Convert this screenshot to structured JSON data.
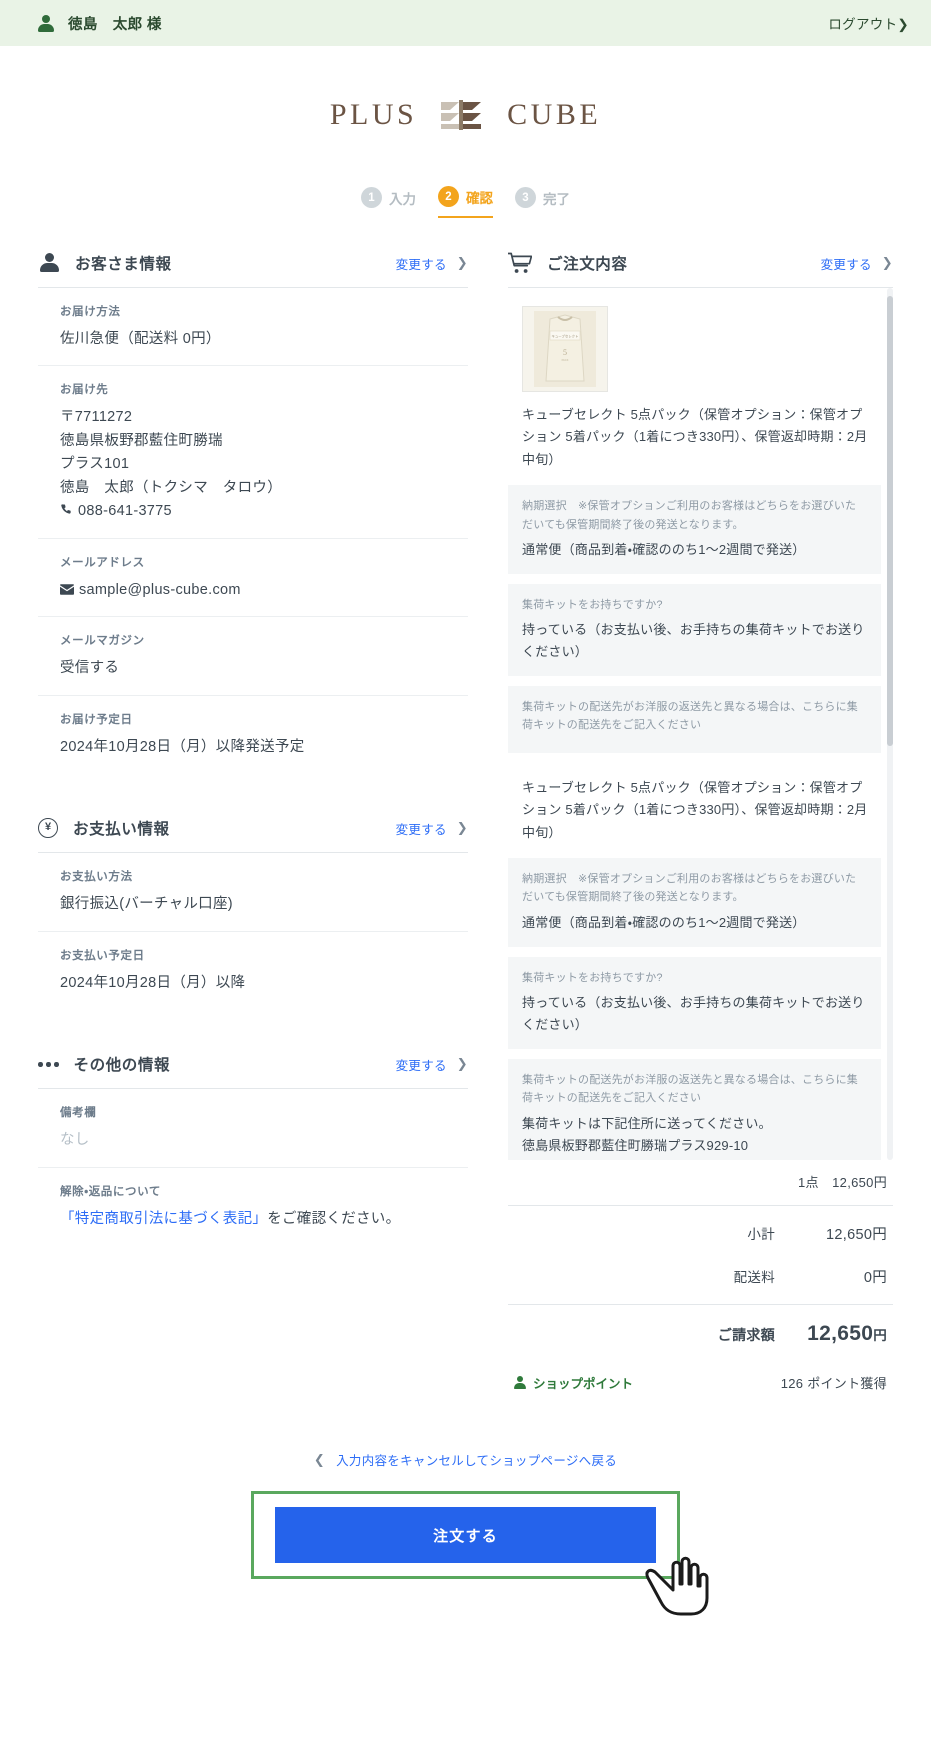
{
  "userbar": {
    "user_icon": "person-icon",
    "username": "徳島　太郎 様",
    "logout_label": "ログアウト",
    "logout_chevron": "❯"
  },
  "brand": {
    "left_word": "PLUS",
    "right_word": "CUBE",
    "mark": "cube-logo-mark"
  },
  "steps": [
    {
      "number": "1",
      "label": "入力",
      "active": false
    },
    {
      "number": "2",
      "label": "確認",
      "active": true
    },
    {
      "number": "3",
      "label": "完了",
      "active": false
    }
  ],
  "customer": {
    "icon": "person-icon",
    "title": "お客さま情報",
    "change_label": "変更する",
    "chevron": "❯",
    "fields": [
      {
        "label": "お届け方法",
        "value": "佐川急便（配送料 0円）"
      },
      {
        "label": "お届け先",
        "value": "〒7711272\n徳島県板野郡藍住町勝瑞\nプラス101\n徳島　太郎（トクシマ　タロウ）",
        "phone": "088-641-3775",
        "phone_icon": "phone-icon"
      },
      {
        "label": "メールアドレス",
        "value": "sample@plus-cube.com",
        "icon": "mail-icon"
      },
      {
        "label": "メールマガジン",
        "value": "受信する"
      },
      {
        "label": "お届け予定日",
        "value": "2024年10月28日（月）以降発送予定"
      }
    ]
  },
  "payment": {
    "icon": "yen-circle-icon",
    "title": "お支払い情報",
    "change_label": "変更する",
    "chevron": "❯",
    "fields": [
      {
        "label": "お支払い方法",
        "value": "銀行振込(バーチャル口座)"
      },
      {
        "label": "お支払い予定日",
        "value": "2024年10月28日（月）以降"
      }
    ]
  },
  "other": {
    "icon": "ellipsis-icon",
    "title": "その他の情報",
    "change_label": "変更する",
    "chevron": "❯",
    "remarks_label": "備考欄",
    "remarks_value": "なし",
    "return_label": "解除・返品について",
    "return_link_text": "「特定商取引法に基づく表記」",
    "return_suffix": "をご確認ください。"
  },
  "order": {
    "icon": "cart-icon",
    "title": "ご注文内容",
    "change_label": "変更する",
    "chevron": "❯",
    "items": [
      {
        "thumb": "product-thumbnail",
        "name": "キューブセレクト 5点パック（保管オプション：保管オプション 5着パック（1着につき330円）、保管返却時期：2月中旬）",
        "options": [
          {
            "question": "納期選択　※保管オプションご利用のお客様はどちらをお選びいただいても保管期間終了後の発送となります。",
            "answer": "通常便（商品到着・確認ののち1〜2週間で発送）"
          },
          {
            "question": "集荷キットをお持ちですか?",
            "answer": "持っている（お支払い後、お手持ちの集荷キットでお送りください）"
          },
          {
            "question": "集荷キットの配送先がお洋服の返送先と異なる場合は、こちらに集荷キットの配送先をご記入ください",
            "answer": ""
          }
        ]
      },
      {
        "thumb": "product-thumbnail",
        "name": "キューブセレクト 5点パック（保管オプション：保管オプション 5着パック（1着につき330円）、保管返却時期：2月中旬）",
        "options": [
          {
            "question": "納期選択　※保管オプションご利用のお客様はどちらをお選びいただいても保管期間終了後の発送となります。",
            "answer": "通常便（商品到着・確認ののち1〜2週間で発送）"
          },
          {
            "question": "集荷キットをお持ちですか?",
            "answer": "持っている（お支払い後、お手持ちの集荷キットでお送りください）"
          },
          {
            "question": "集荷キットの配送先がお洋服の返送先と異なる場合は、こちらに集荷キットの配送先をご記入ください",
            "answer": "集荷キットは下記住所に送ってください。\n徳島県板野郡藍住町勝瑞プラス929-10"
          }
        ]
      }
    ],
    "qty_line": "1点　12,650円",
    "totals": [
      {
        "label": "小計",
        "value": "12,650円"
      },
      {
        "label": "配送料",
        "value": "0円"
      }
    ],
    "grand_label": "ご請求額",
    "grand_amount": "12,650",
    "grand_yen": "円",
    "points_icon": "person-icon",
    "points_label": "ショップポイント",
    "points_value": "126 ポイント獲得"
  },
  "bottom": {
    "cancel_chevron": "❮",
    "cancel_label": "入力内容をキャンセルしてショップページへ戻る",
    "submit_label": "注文する",
    "cursor": "hand-cursor-icon"
  },
  "colors": {
    "userbar_bg": "#e9f3e6",
    "accent_orange": "#f3a41c",
    "link_blue": "#2d6df6",
    "button_blue": "#2563eb",
    "highlight_green": "#5aa85e",
    "points_green": "#2f7a3b"
  }
}
